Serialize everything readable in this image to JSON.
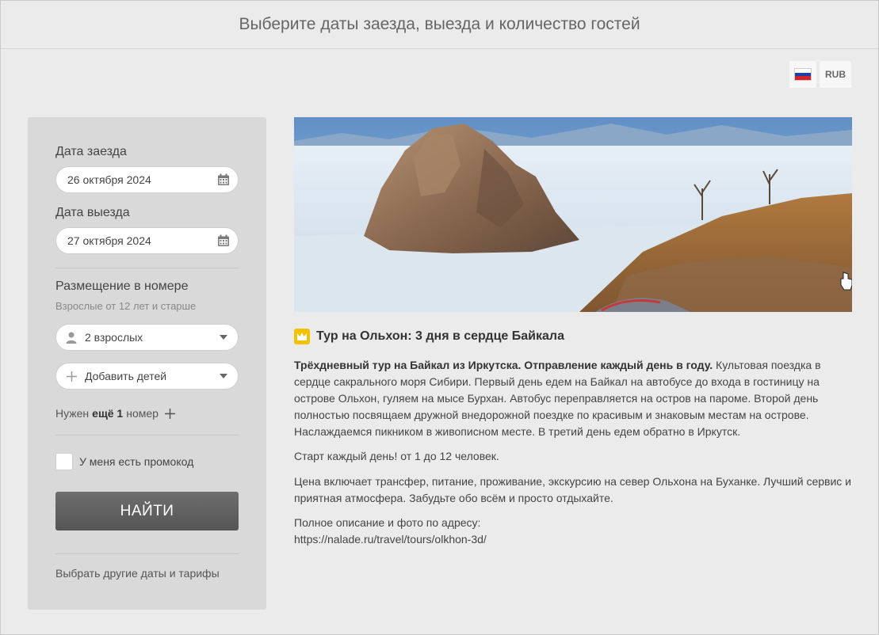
{
  "header": {
    "title": "Выберите даты заезда, выезда и количество гостей"
  },
  "topbar": {
    "language_icon": "russia-flag-icon",
    "currency": "RUB"
  },
  "form": {
    "checkin_label": "Дата заезда",
    "checkin_value": "26 октября 2024",
    "checkout_label": "Дата выезда",
    "checkout_value": "27 октября 2024",
    "accommodation_label": "Размещение в номере",
    "accommodation_hint": "Взрослые от 12 лет и старше",
    "adults_value": "2 взрослых",
    "children_value": "Добавить детей",
    "need_room_prefix": "Нужен",
    "need_room_bold": "ещё 1",
    "need_room_suffix": "номер",
    "promo_label": "У меня есть промокод",
    "search_button": "НАЙТИ",
    "other_dates_link": "Выбрать другие даты и тарифы"
  },
  "tour": {
    "title": "Тур на Ольхон: 3 дня в сердце Байкала",
    "intro_bold": "Трёхдневный тур на Байкал из Иркутска. Отправление каждый день в году.",
    "intro_text": " Культовая поездка в сердце сакрального моря Сибири. Первый день едем на Байкал на автобусе до входа в гостиницу на острове Ольхон, гуляем на мысе Бурхан. Автобус переправляется на остров на пароме. Второй день полностью посвящаем дружной внедорожной поездке по красивым и знаковым местам на острове. Наслаждаемся пикником в живописном месте. В третий день едем обратно в Иркутск.",
    "start_text": "Старт каждый день! от 1 до 12 человек.",
    "price_text": "Цена включает трансфер, питание, проживание, экскурсию на север Ольхона на Буханке. Лучший сервис и приятная атмосфера. Забудьте обо всём и просто отдыхайте.",
    "full_desc_label": "Полное описание и фото по адресу:",
    "url": "https://nalade.ru/travel/tours/olkhon-3d/"
  },
  "colors": {
    "background": "#ebebeb",
    "panel": "#d9d9d9",
    "button": "#5f5f5f",
    "crown": "#f2c200"
  }
}
